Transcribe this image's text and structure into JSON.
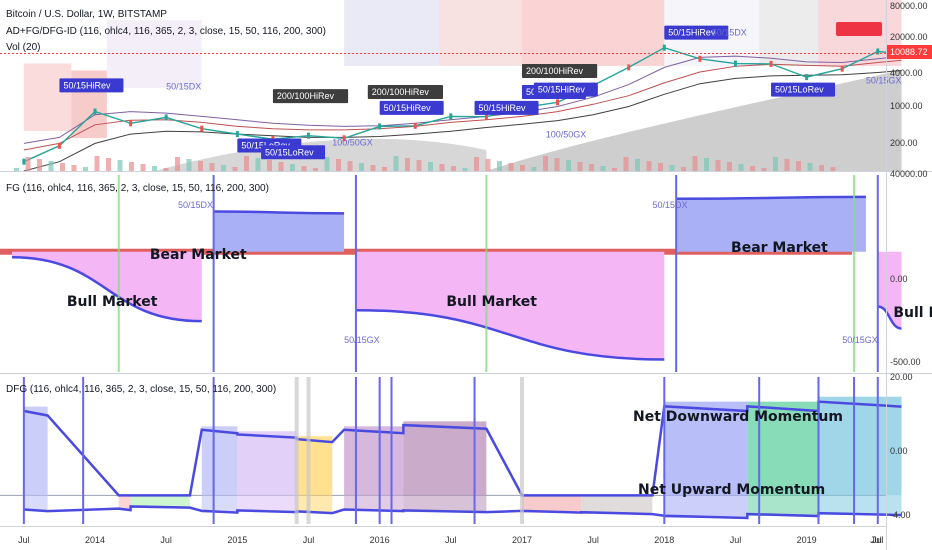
{
  "header": {
    "title": "Bitcoin / U.S. Dollar, 1W, BITSTAMP",
    "indicator": "AD+FG/DFG-ID (116, ohlc4, 116, 365, 2, 3, close, 15, 50, 116, 200, 300)",
    "volume": "Vol (20)"
  },
  "pane2": {
    "title": "FG (116, ohlc4, 116, 365, 2, 3, close, 15, 50, 116, 200, 300)"
  },
  "pane3": {
    "title": "DFG (116, ohlc4, 116, 365, 2, 3, close, 15, 50, 116, 200, 300)"
  },
  "colors": {
    "bull": "#f4b6f4",
    "bear": "#aab0f5",
    "line": "#4a4ae0",
    "price_tag": "#ff3a3a",
    "green_mark": "#7ee27e",
    "blue_mark": "#6666ee"
  },
  "chart_data": [
    {
      "type": "line",
      "name": "price",
      "scale": "log",
      "y_ticks": [
        "80000.00",
        "20000.00",
        "10088.72",
        "4000.00",
        "1000.00",
        "200.00"
      ],
      "last_price": "10088.72",
      "x": [
        "2013-07",
        "2013-10",
        "2014-01",
        "2014-04",
        "2014-07",
        "2014-10",
        "2015-01",
        "2015-04",
        "2015-07",
        "2015-10",
        "2016-01",
        "2016-04",
        "2016-07",
        "2016-10",
        "2017-01",
        "2017-04",
        "2017-07",
        "2017-10",
        "2018-01",
        "2018-04",
        "2018-07",
        "2018-10",
        "2019-01",
        "2019-04",
        "2019-07",
        "2019-09"
      ],
      "values": [
        90,
        180,
        800,
        480,
        620,
        380,
        300,
        240,
        280,
        250,
        420,
        430,
        650,
        640,
        950,
        1200,
        2500,
        5500,
        13000,
        8000,
        6500,
        6400,
        3600,
        5200,
        11000,
        10088
      ],
      "annotations": [
        "50/15HiRev",
        "50/15DX",
        "50/15LoRev",
        "50/15LoRev",
        "200/100HiRev",
        "200/100HiRev",
        "50/15HiRev",
        "50/15HiRev",
        "200/100HiRev",
        "50/15HiRev",
        "50/15HiRev",
        "100/50GX",
        "100/50GX",
        "50/15HiRev",
        "50/15DX",
        "50/15LoRev",
        "50/15GX"
      ]
    },
    {
      "type": "area",
      "name": "FG",
      "y_ticks": [
        "40000.00",
        "0.00",
        "-500.00"
      ],
      "regions": [
        "Bull Market",
        "Bear Market",
        "Bull Market",
        "Bear Market",
        "Bull Ma"
      ],
      "markers": [
        "50/15DX",
        "50/15DX",
        "50/15GX",
        "50/15GX"
      ],
      "x": [
        "2013-06",
        "2014-10",
        "2014-11",
        "2015-10",
        "2015-11",
        "2018-01",
        "2018-02",
        "2019-06",
        "2019-07",
        "2019-09"
      ],
      "values": [
        -30,
        -380,
        220,
        210,
        -320,
        -590,
        290,
        300,
        -300,
        -420
      ]
    },
    {
      "type": "area",
      "name": "DFG",
      "y_ticks": [
        "20.00",
        "0.00",
        "-4.00"
      ],
      "regions": [
        "Net Downward Momentum",
        "Net Upward Momentum"
      ],
      "x_labels": [
        "Jul",
        "2014",
        "Jul",
        "2015",
        "Jul",
        "2016",
        "Jul",
        "2017",
        "Jul",
        "2018",
        "Jul",
        "2019",
        "Jul",
        "Jul"
      ]
    }
  ]
}
